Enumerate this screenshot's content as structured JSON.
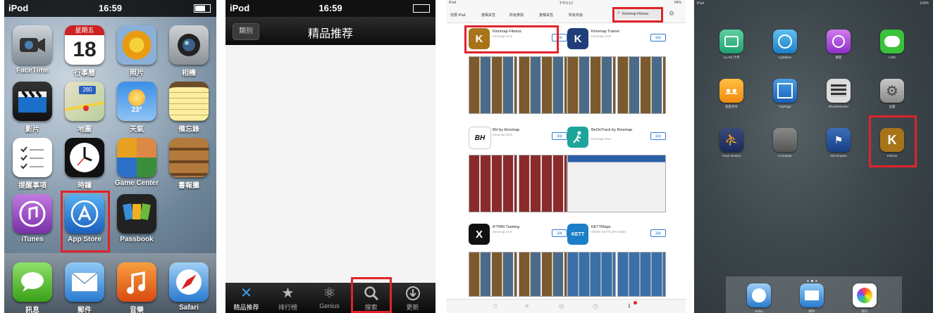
{
  "panel1": {
    "status": {
      "device": "iPod",
      "time": "16:59"
    },
    "apps": [
      {
        "label": "FaceTime"
      },
      {
        "label": "行事曆",
        "date_day": "星期五",
        "date_num": "18"
      },
      {
        "label": "照片"
      },
      {
        "label": "相機"
      },
      {
        "label": "影片"
      },
      {
        "label": "地圖",
        "map_badge": "280"
      },
      {
        "label": "天氣",
        "temp": "23°"
      },
      {
        "label": "備忘錄"
      },
      {
        "label": "提醒事項"
      },
      {
        "label": "時鐘"
      },
      {
        "label": "Game Center"
      },
      {
        "label": "書報攤"
      },
      {
        "label": "iTunes"
      },
      {
        "label": "App Store"
      },
      {
        "label": "Passbook"
      }
    ],
    "dock": [
      {
        "label": "訊息"
      },
      {
        "label": "郵件"
      },
      {
        "label": "音樂"
      },
      {
        "label": "Safari"
      }
    ]
  },
  "panel2": {
    "status": {
      "device": "iPod",
      "time": "16:59"
    },
    "back_label": "類別",
    "title": "精品推荐",
    "tabs": [
      {
        "label": "精品推荐"
      },
      {
        "label": "排行榜"
      },
      {
        "label": "Genius"
      },
      {
        "label": "搜索"
      },
      {
        "label": "更新"
      }
    ]
  },
  "panel3": {
    "status": {
      "device": "iPad",
      "time": "下午5:12",
      "battery": "84%"
    },
    "segments": [
      "仅限 iPad",
      "按相关性",
      "所有类别",
      "按相关性",
      "所有年龄"
    ],
    "search_value": "Kinomap Fitness",
    "cards": [
      {
        "name": "Kinomap Fitness",
        "sub": "Kinomap SAS",
        "get": "获取",
        "icon": "K"
      },
      {
        "name": "Kinomap Trainer",
        "sub": "Kinomap SAS",
        "get": "获取",
        "icon": "K"
      },
      {
        "name": "BH by Kinomap",
        "sub": "Kinomap SAS",
        "get": "获取",
        "icon": "BH"
      },
      {
        "name": "BeOnTrack by Kinomap",
        "sub": "Kinomap SAS",
        "get": "获取",
        "icon": ""
      },
      {
        "name": "iFTWN Training",
        "sub": "Kinomap SAS",
        "get": "获取",
        "icon": "X"
      },
      {
        "name": "KETTMaps",
        "sub": "HEINZ KETTLER GmbH",
        "get": "获取",
        "icon": "KETT"
      }
    ]
  },
  "panel4": {
    "status": {
      "device": "iPad",
      "battery": "100%"
    },
    "apps": [
      {
        "label": "ALANI 计步"
      },
      {
        "label": "Lightblue"
      },
      {
        "label": "播客"
      },
      {
        "label": "LINE"
      },
      {
        "label": "家庭共享"
      },
      {
        "label": "TopPage"
      },
      {
        "label": "RhodeMonitor"
      },
      {
        "label": "设置"
      },
      {
        "label": "Track Monitor"
      },
      {
        "label": "iCompete"
      },
      {
        "label": "FitCompete"
      },
      {
        "label": "Fitness",
        "icon": "K"
      }
    ],
    "dock": [
      {
        "label": "Safari"
      },
      {
        "label": "邮件"
      },
      {
        "label": "照片"
      }
    ]
  },
  "colors": {
    "highlight": "#e0232b",
    "kinomap_brown": "#a8741a"
  }
}
